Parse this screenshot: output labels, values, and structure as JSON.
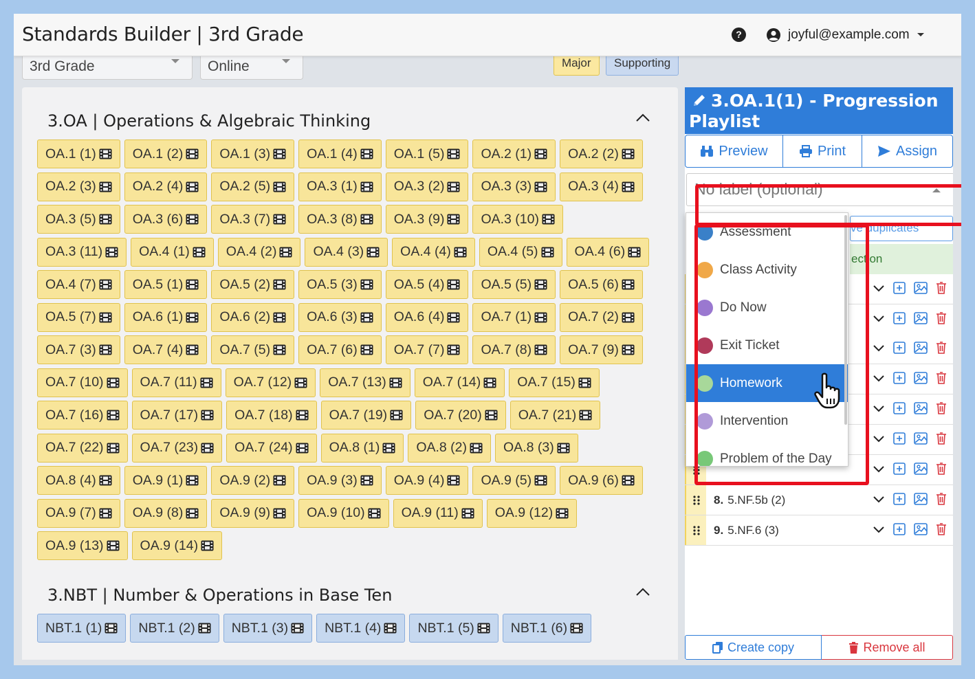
{
  "header": {
    "title": "Standards Builder | 3rd Grade",
    "help_icon": "?",
    "user_email": "joyful@example.com"
  },
  "filters": {
    "grade": "3rd Grade",
    "mode": "Online"
  },
  "legend": {
    "major": "Major",
    "supporting": "Supporting"
  },
  "colors": {
    "major_bg": "#f8e59a",
    "supporting_bg": "#c6d8ef",
    "accent": "#2f7dd9",
    "danger": "#d9363e",
    "highlight": "#e8101e"
  },
  "domains": [
    {
      "title": "3.OA | Operations & Algebraic Thinking",
      "type": "major",
      "rows": [
        [
          "OA.1 (1)",
          "OA.1 (2)",
          "OA.1 (3)",
          "OA.1 (4)",
          "OA.1 (5)",
          "OA.2 (1)",
          "OA.2 (2)"
        ],
        [
          "OA.2 (3)",
          "OA.2 (4)",
          "OA.2 (5)",
          "OA.3 (1)",
          "OA.3 (2)",
          "OA.3 (3)",
          "OA.3 (4)"
        ],
        [
          "OA.3 (5)",
          "OA.3 (6)",
          "OA.3 (7)",
          "OA.3 (8)",
          "OA.3 (9)",
          "OA.3 (10)"
        ],
        [
          "OA.3 (11)",
          "OA.4 (1)",
          "OA.4 (2)",
          "OA.4 (3)",
          "OA.4 (4)",
          "OA.4 (5)",
          "OA.4 (6)"
        ],
        [
          "OA.4 (7)",
          "OA.5 (1)",
          "OA.5 (2)",
          "OA.5 (3)",
          "OA.5 (4)",
          "OA.5 (5)",
          "OA.5 (6)"
        ],
        [
          "OA.5 (7)",
          "OA.6 (1)",
          "OA.6 (2)",
          "OA.6 (3)",
          "OA.6 (4)",
          "OA.7 (1)",
          "OA.7 (2)"
        ],
        [
          "OA.7 (3)",
          "OA.7 (4)",
          "OA.7 (5)",
          "OA.7 (6)",
          "OA.7 (7)",
          "OA.7 (8)",
          "OA.7 (9)"
        ],
        [
          "OA.7 (10)",
          "OA.7 (11)",
          "OA.7 (12)",
          "OA.7 (13)",
          "OA.7 (14)",
          "OA.7 (15)"
        ],
        [
          "OA.7 (16)",
          "OA.7 (17)",
          "OA.7 (18)",
          "OA.7 (19)",
          "OA.7 (20)",
          "OA.7 (21)"
        ],
        [
          "OA.7 (22)",
          "OA.7 (23)",
          "OA.7 (24)",
          "OA.8 (1)",
          "OA.8 (2)",
          "OA.8 (3)"
        ],
        [
          "OA.8 (4)",
          "OA.9 (1)",
          "OA.9 (2)",
          "OA.9 (3)",
          "OA.9 (4)",
          "OA.9 (5)",
          "OA.9 (6)"
        ],
        [
          "OA.9 (7)",
          "OA.9 (8)",
          "OA.9 (9)",
          "OA.9 (10)",
          "OA.9 (11)",
          "OA.9 (12)"
        ],
        [
          "OA.9 (13)",
          "OA.9 (14)"
        ]
      ]
    },
    {
      "title": "3.NBT | Number & Operations in Base Ten",
      "type": "supporting",
      "rows": [
        [
          "NBT.1 (1)",
          "NBT.1 (2)",
          "NBT.1 (3)",
          "NBT.1 (4)",
          "NBT.1 (5)",
          "NBT.1 (6)"
        ]
      ]
    }
  ],
  "playlist": {
    "title": "3.OA.1(1) - Progression Playlist",
    "preview_label": "Preview",
    "print_label": "Print",
    "assign_label": "Assign",
    "label_placeholder": "No label (optional)",
    "remove_duplicates_partial": "ve duplicates",
    "section_partial": "ection",
    "items": [
      {
        "num": "8.",
        "label": "5.NF.5b (2)"
      },
      {
        "num": "9.",
        "label": "5.NF.6 (3)"
      }
    ],
    "create_copy_label": "Create copy",
    "remove_all_label": "Remove all"
  },
  "label_options": [
    {
      "label": "Assessment",
      "color": "#3a80c8",
      "selected": false
    },
    {
      "label": "Class Activity",
      "color": "#f0a848",
      "selected": false
    },
    {
      "label": "Do Now",
      "color": "#9a78d0",
      "selected": false
    },
    {
      "label": "Exit Ticket",
      "color": "#b03a5a",
      "selected": false
    },
    {
      "label": "Homework",
      "color": "#a8d89a",
      "selected": true
    },
    {
      "label": "Intervention",
      "color": "#b09ad8",
      "selected": false
    },
    {
      "label": "Problem of the Day",
      "color": "#78c878",
      "selected": false
    }
  ]
}
